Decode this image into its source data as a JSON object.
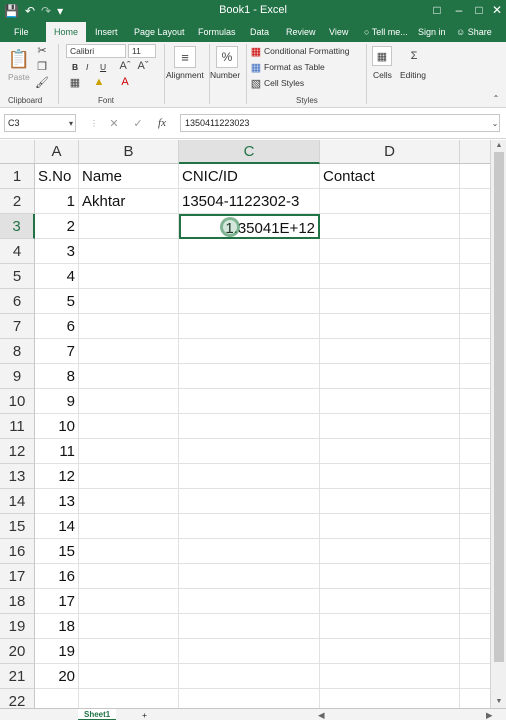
{
  "app": {
    "title": "Book1 - Excel",
    "accent": "#217346"
  },
  "quick_access": {
    "save_icon": "save-icon",
    "undo_icon": "undo-icon",
    "redo_icon": "redo-icon"
  },
  "tabs": [
    "File",
    "Home",
    "Insert",
    "Page Layout",
    "Formulas",
    "Data",
    "Review",
    "View"
  ],
  "active_tab": "Home",
  "tell_me": "Tell me...",
  "sign_in": "Sign in",
  "share": "Share",
  "ribbon": {
    "clipboard": {
      "label": "Clipboard",
      "paste": "Paste"
    },
    "font": {
      "label": "Font",
      "name": "Calibri",
      "size": "11",
      "bold": "B",
      "italic": "I",
      "underline": "U"
    },
    "alignment": "Alignment",
    "number": "Number",
    "percent": "%",
    "styles": {
      "label": "Styles",
      "conditional": "Conditional Formatting",
      "format_table": "Format as Table",
      "cell_styles": "Cell Styles"
    },
    "cells": "Cells",
    "editing": "Editing"
  },
  "formula_bar": {
    "name_box": "C3",
    "formula": "1350411223023"
  },
  "sheet": {
    "columns": [
      "A",
      "B",
      "C",
      "D"
    ],
    "selected_column": "C",
    "selected_row": "3",
    "rows": [
      {
        "n": "1",
        "a": "S.No",
        "b": "Name",
        "c": "CNIC/ID",
        "d": "Contact"
      },
      {
        "n": "2",
        "a": "1",
        "b": "Akhtar",
        "c": "13504-1122302-3",
        "d": ""
      },
      {
        "n": "3",
        "a": "2",
        "b": "",
        "c": "1.35041E+12",
        "d": ""
      },
      {
        "n": "4",
        "a": "3"
      },
      {
        "n": "5",
        "a": "4"
      },
      {
        "n": "6",
        "a": "5"
      },
      {
        "n": "7",
        "a": "6"
      },
      {
        "n": "8",
        "a": "7"
      },
      {
        "n": "9",
        "a": "8"
      },
      {
        "n": "10",
        "a": "9"
      },
      {
        "n": "11",
        "a": "10"
      },
      {
        "n": "12",
        "a": "11"
      },
      {
        "n": "13",
        "a": "12"
      },
      {
        "n": "14",
        "a": "13"
      },
      {
        "n": "15",
        "a": "14"
      },
      {
        "n": "16",
        "a": "15"
      },
      {
        "n": "17",
        "a": "16"
      },
      {
        "n": "18",
        "a": "17"
      },
      {
        "n": "19",
        "a": "18"
      },
      {
        "n": "20",
        "a": "19"
      },
      {
        "n": "21",
        "a": "20"
      },
      {
        "n": "22",
        "a": ""
      }
    ]
  },
  "sheet_tabs": [
    "Sheet1"
  ],
  "add_sheet": "+"
}
